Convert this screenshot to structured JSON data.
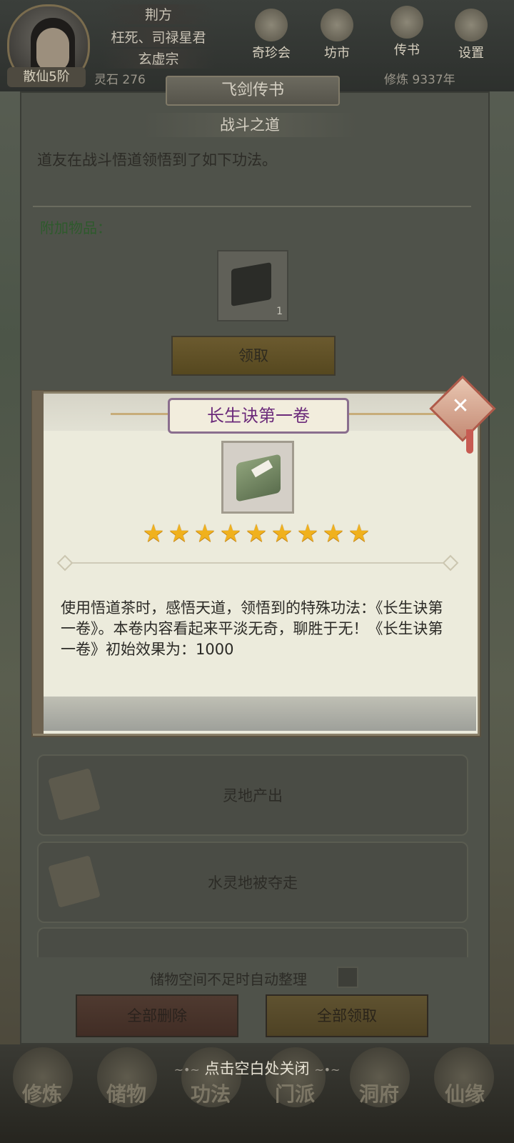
{
  "header": {
    "rank": "散仙5阶",
    "titles": [
      "荆方",
      "枉死、司禄星君",
      "玄虚宗"
    ],
    "stats": {
      "spirit_stone": "灵石 276",
      "cultivation": "修炼 9337年"
    },
    "icons": [
      {
        "label": "奇珍会",
        "icon": "treasure-icon"
      },
      {
        "label": "坊市",
        "icon": "market-icon"
      },
      {
        "label": "传书",
        "icon": "letter-icon"
      },
      {
        "label": "设置",
        "icon": "gear-icon"
      }
    ]
  },
  "letter": {
    "panel_title": "飞剑传书",
    "subtitle": "战斗之道",
    "body": "道友在战斗悟道领悟到了如下功法。",
    "attach_label": "附加物品：",
    "attach_count": "1",
    "claim_label": "领取",
    "mails": [
      {
        "title": "灵地产出"
      },
      {
        "title": "水灵地被夺走"
      }
    ],
    "auto_sort_label": "储物空间不足时自动整理",
    "delete_all_label": "全部删除",
    "claim_all_label": "全部领取"
  },
  "modal": {
    "title": "长生诀第一卷",
    "stars": 9,
    "description": "使用悟道茶时，感悟天道，领悟到的特殊功法：《长生诀第一卷》。本卷内容看起来平淡无奇，聊胜于无！《长生诀第一卷》初始效果为：1000"
  },
  "bottom_nav": {
    "items": [
      "修炼",
      "储物",
      "功法",
      "门派",
      "洞府",
      "仙缘"
    ],
    "close_hint": "点击空白处关闭"
  },
  "colors": {
    "modal_title": "#6b2a7a",
    "star": "#f0b11d",
    "attach_label": "#2e5a2c"
  }
}
